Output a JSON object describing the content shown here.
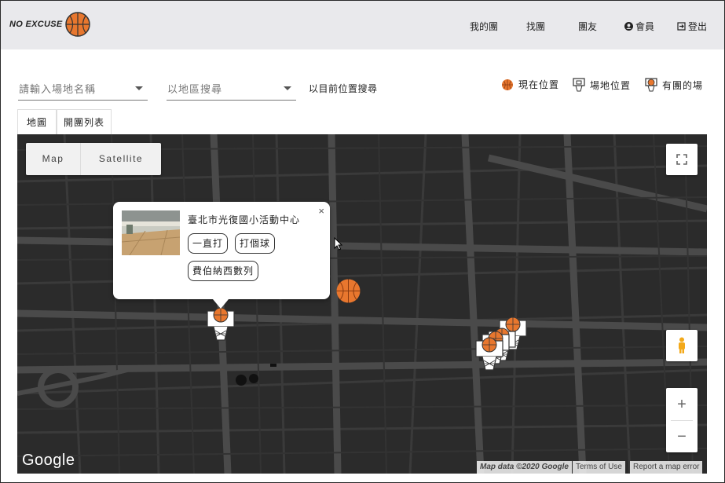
{
  "header": {
    "logo_text": "NO EXCUSE",
    "nav": {
      "my_groups": "我的團",
      "find_groups": "找團",
      "friends": "團友",
      "member": "會員",
      "logout": "登出"
    }
  },
  "search": {
    "venue_placeholder": "請輸入場地名稱",
    "region_placeholder": "以地區搜尋",
    "locate_label": "以目前位置搜尋"
  },
  "legend": {
    "current_position": "現在位置",
    "venue_position": "場地位置",
    "has_group": "有團的場"
  },
  "tabs": {
    "map": "地圖",
    "group_list": "開團列表"
  },
  "map": {
    "map_type": {
      "map": "Map",
      "satellite": "Satellite"
    },
    "zoom_in": "+",
    "zoom_out": "−",
    "google_logo": "Google",
    "attribution": {
      "map_data": "Map data ©2020 Google",
      "terms": "Terms of Use",
      "report": "Report a map error"
    },
    "colors": {
      "background": "#2b2b2b",
      "streets": "#4a4a4a",
      "accent_ball": "#e8772e"
    }
  },
  "info_window": {
    "venue_name": "臺北市光復國小活動中心",
    "close": "×",
    "groups": [
      "一直打",
      "打個球",
      "費伯納西數列"
    ]
  }
}
